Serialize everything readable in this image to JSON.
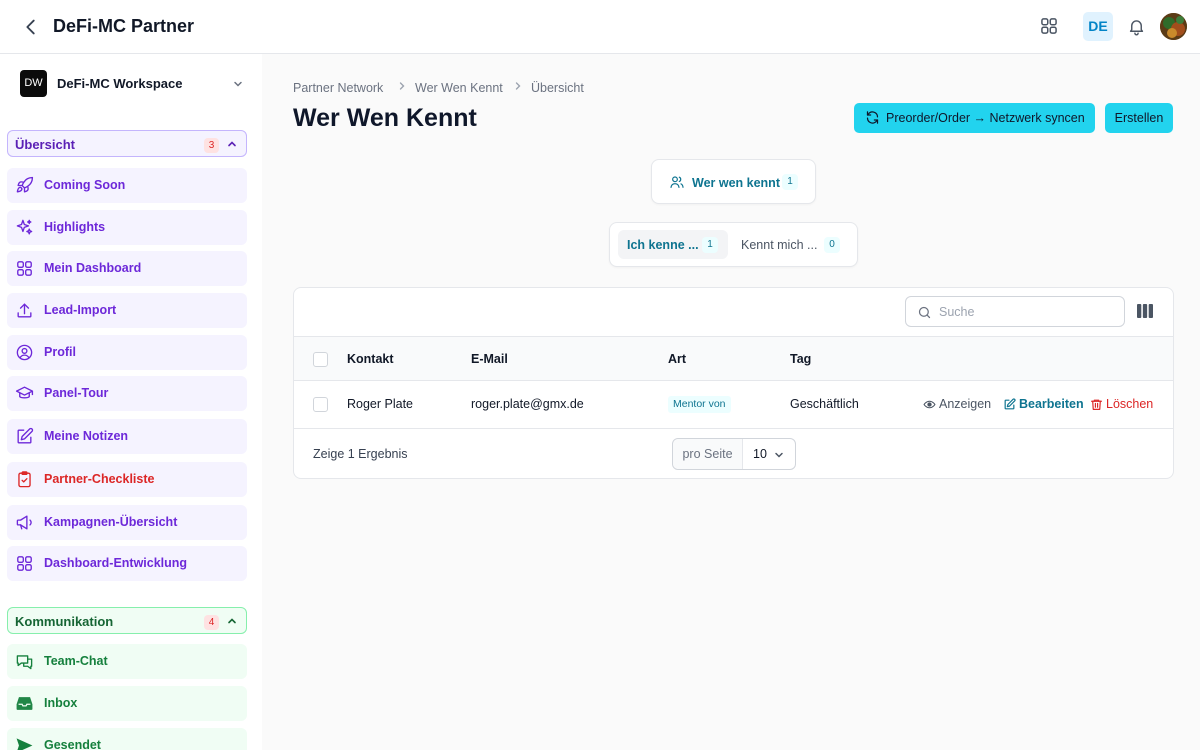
{
  "app": {
    "title": "DeFi-MC Partner",
    "lang": "DE"
  },
  "workspace": {
    "logo": "DW",
    "name": "DeFi-MC Workspace"
  },
  "sidebar": {
    "sections": [
      {
        "label": "Übersicht",
        "count": "3",
        "color": "#6d28d9"
      },
      {
        "label": "Kommunikation",
        "count": "4",
        "color": "#15803d"
      }
    ],
    "items": [
      {
        "label": "Coming Soon",
        "icon": "rocket-icon"
      },
      {
        "label": "Highlights",
        "icon": "sparkles-icon"
      },
      {
        "label": "Mein Dashboard",
        "icon": "grid-icon"
      },
      {
        "label": "Lead-Import",
        "icon": "upload-icon"
      },
      {
        "label": "Profil",
        "icon": "user-circle-icon"
      },
      {
        "label": "Panel-Tour",
        "icon": "graduation-cap-icon"
      },
      {
        "label": "Meine Notizen",
        "icon": "edit-icon"
      },
      {
        "label": "Partner-Checkliste",
        "icon": "clipboard-check-icon"
      },
      {
        "label": "Kampagnen-Übersicht",
        "icon": "megaphone-icon"
      },
      {
        "label": "Dashboard-Entwicklung",
        "icon": "grid-icon"
      },
      {
        "label": "Team-Chat",
        "icon": "chat-icon"
      },
      {
        "label": "Inbox",
        "icon": "inbox-icon"
      },
      {
        "label": "Gesendet",
        "icon": "send-icon"
      }
    ]
  },
  "breadcrumb": [
    "Partner Network",
    "Wer Wen Kennt",
    "Übersicht"
  ],
  "page": {
    "title": "Wer Wen Kennt"
  },
  "actions": {
    "sync_label": "Preorder/Order → Netzwerk syncen",
    "create_label": "Erstellen"
  },
  "main_tab": {
    "label": "Wer wen kennt",
    "count": "1"
  },
  "segments": [
    {
      "label": "Ich kenne ...",
      "count": "1"
    },
    {
      "label": "Kennt mich ...",
      "count": "0"
    }
  ],
  "search": {
    "placeholder": "Suche"
  },
  "table": {
    "columns": [
      "Kontakt",
      "E-Mail",
      "Art",
      "Tag"
    ],
    "rows": [
      {
        "contact": "Roger Plate",
        "email": "roger.plate@gmx.de",
        "type": "Mentor von",
        "tag": "Geschäftlich"
      }
    ],
    "row_actions": {
      "view": "Anzeigen",
      "edit": "Bearbeiten",
      "delete": "Löschen"
    },
    "result_text": "Zeige 1 Ergebnis",
    "per_page_label": "pro Seite",
    "per_page_value": "10"
  },
  "colors": {
    "accent": "#22d3ee",
    "teal": "#0e7490",
    "purple": "#6d28d9",
    "green": "#15803d",
    "danger": "#dc2626"
  }
}
